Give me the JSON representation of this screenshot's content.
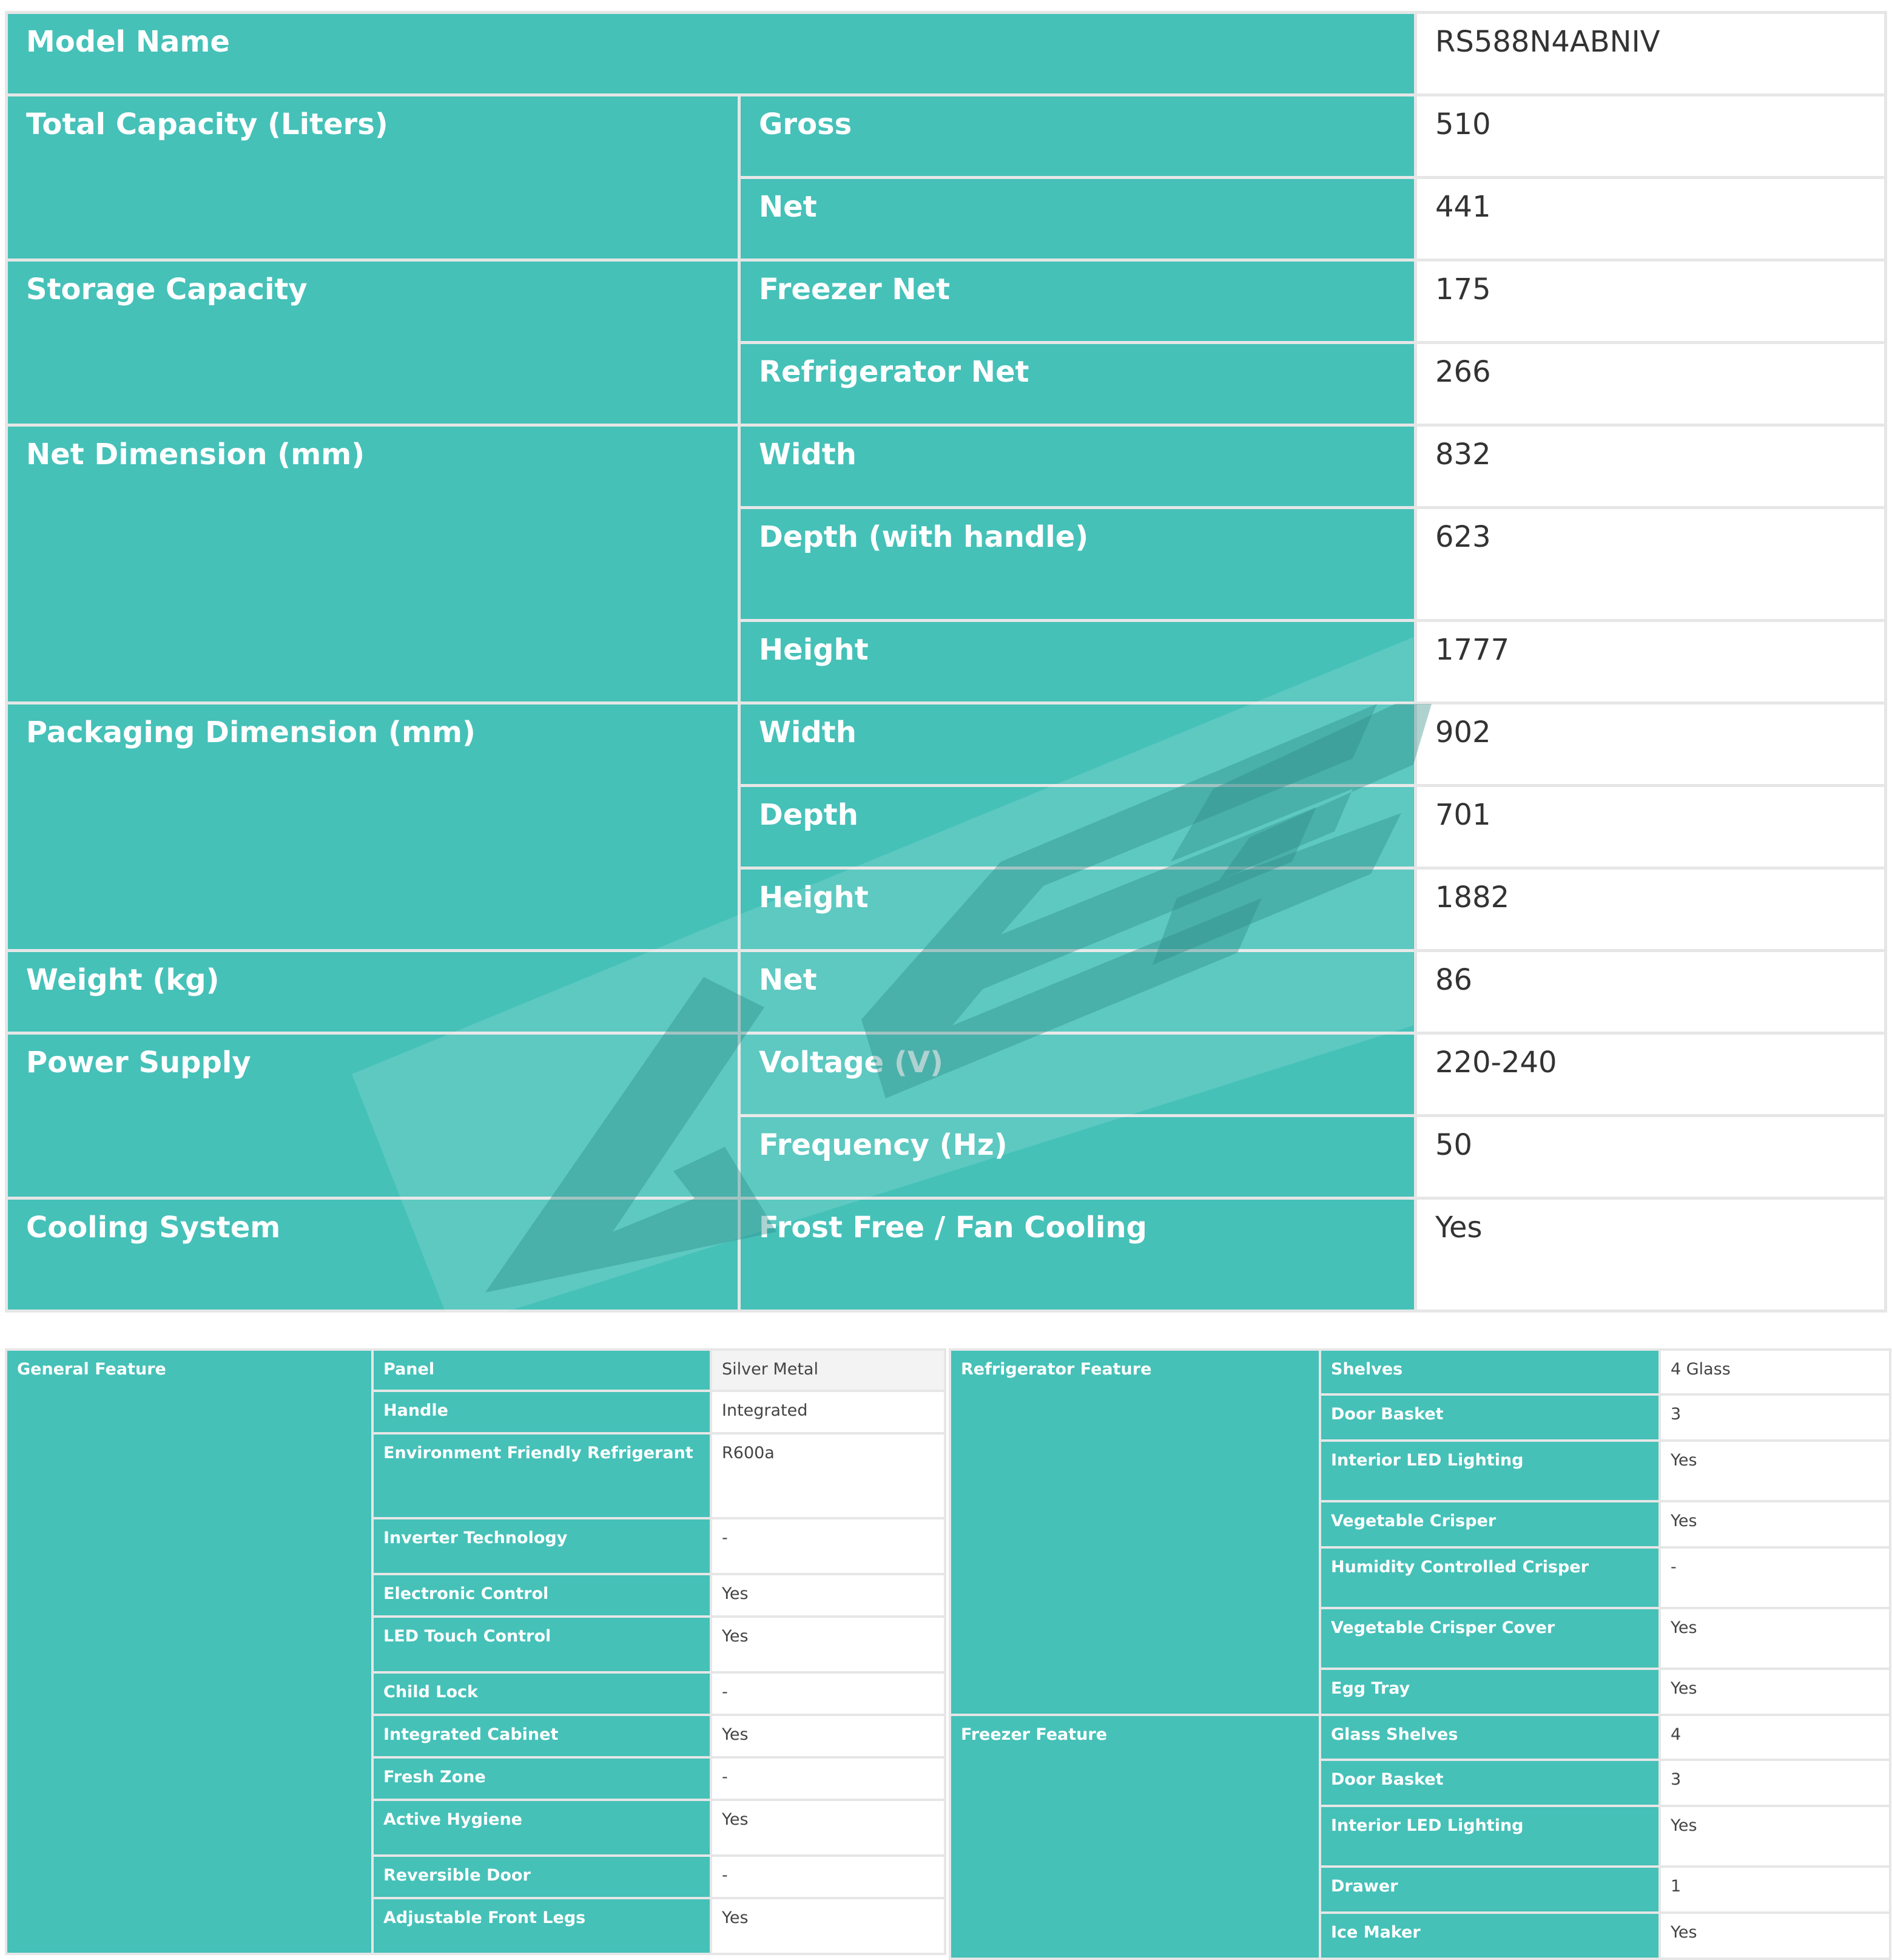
{
  "specs": {
    "model_label": "Model Name",
    "model_value": "RS588N4ABNIV",
    "total_capacity": {
      "label": "Total Capacity (Liters)",
      "gross_label": "Gross",
      "gross": "510",
      "net_label": "Net",
      "net": "441"
    },
    "storage_capacity": {
      "label": "Storage Capacity",
      "freezer_label": "Freezer Net",
      "freezer": "175",
      "fridge_label": "Refrigerator Net",
      "fridge": "266"
    },
    "net_dimension": {
      "label": "Net Dimension (mm)",
      "width_label": "Width",
      "width": "832",
      "depth_label": "Depth (with handle)",
      "depth": "623",
      "height_label": "Height",
      "height": "1777"
    },
    "packaging_dimension": {
      "label": "Packaging Dimension (mm)",
      "width_label": "Width",
      "width": "902",
      "depth_label": "Depth",
      "depth": "701",
      "height_label": "Height",
      "height": "1882"
    },
    "weight": {
      "label": "Weight (kg)",
      "net_label": "Net",
      "net": "86"
    },
    "power_supply": {
      "label": "Power Supply",
      "voltage_label": "Voltage (V)",
      "voltage": "220-240",
      "frequency_label": "Frequency (Hz)",
      "frequency": "50"
    },
    "cooling_system": {
      "label": "Cooling System",
      "type_label": "Frost Free / Fan Cooling",
      "type": "Yes"
    }
  },
  "general": {
    "label": "General Feature",
    "rows": [
      {
        "label": "Panel",
        "value": "Silver Metal"
      },
      {
        "label": "Handle",
        "value": "Integrated"
      },
      {
        "label": "Environment Friendly Refrigerant",
        "value": "R600a"
      },
      {
        "label": "Inverter Technology",
        "value": "-"
      },
      {
        "label": "Electronic Control",
        "value": "Yes"
      },
      {
        "label": "LED Touch Control",
        "value": "Yes"
      },
      {
        "label": "Child Lock",
        "value": "-"
      },
      {
        "label": "Integrated Cabinet",
        "value": "Yes"
      },
      {
        "label": "Fresh Zone",
        "value": "-"
      },
      {
        "label": "Active Hygiene",
        "value": "Yes"
      },
      {
        "label": "Reversible Door",
        "value": "-"
      },
      {
        "label": "Adjustable Front Legs",
        "value": "Yes"
      }
    ]
  },
  "refrigerator": {
    "label": "Refrigerator Feature",
    "rows": [
      {
        "label": "Shelves",
        "value": "4 Glass"
      },
      {
        "label": "Door Basket",
        "value": "3"
      },
      {
        "label": "Interior LED Lighting",
        "value": "Yes"
      },
      {
        "label": "Vegetable Crisper",
        "value": "Yes"
      },
      {
        "label": "Humidity Controlled Crisper",
        "value": "-"
      },
      {
        "label": "Vegetable Crisper Cover",
        "value": "Yes"
      },
      {
        "label": "Egg Tray",
        "value": "Yes"
      }
    ]
  },
  "freezer": {
    "label": "Freezer Feature",
    "rows": [
      {
        "label": "Glass Shelves",
        "value": "4"
      },
      {
        "label": "Door Basket",
        "value": "3"
      },
      {
        "label": "Interior LED Lighting",
        "value": "Yes"
      },
      {
        "label": "Drawer",
        "value": "1"
      },
      {
        "label": "Ice Maker",
        "value": "Yes"
      }
    ]
  },
  "watermark": {
    "color": "#2e8a86"
  }
}
